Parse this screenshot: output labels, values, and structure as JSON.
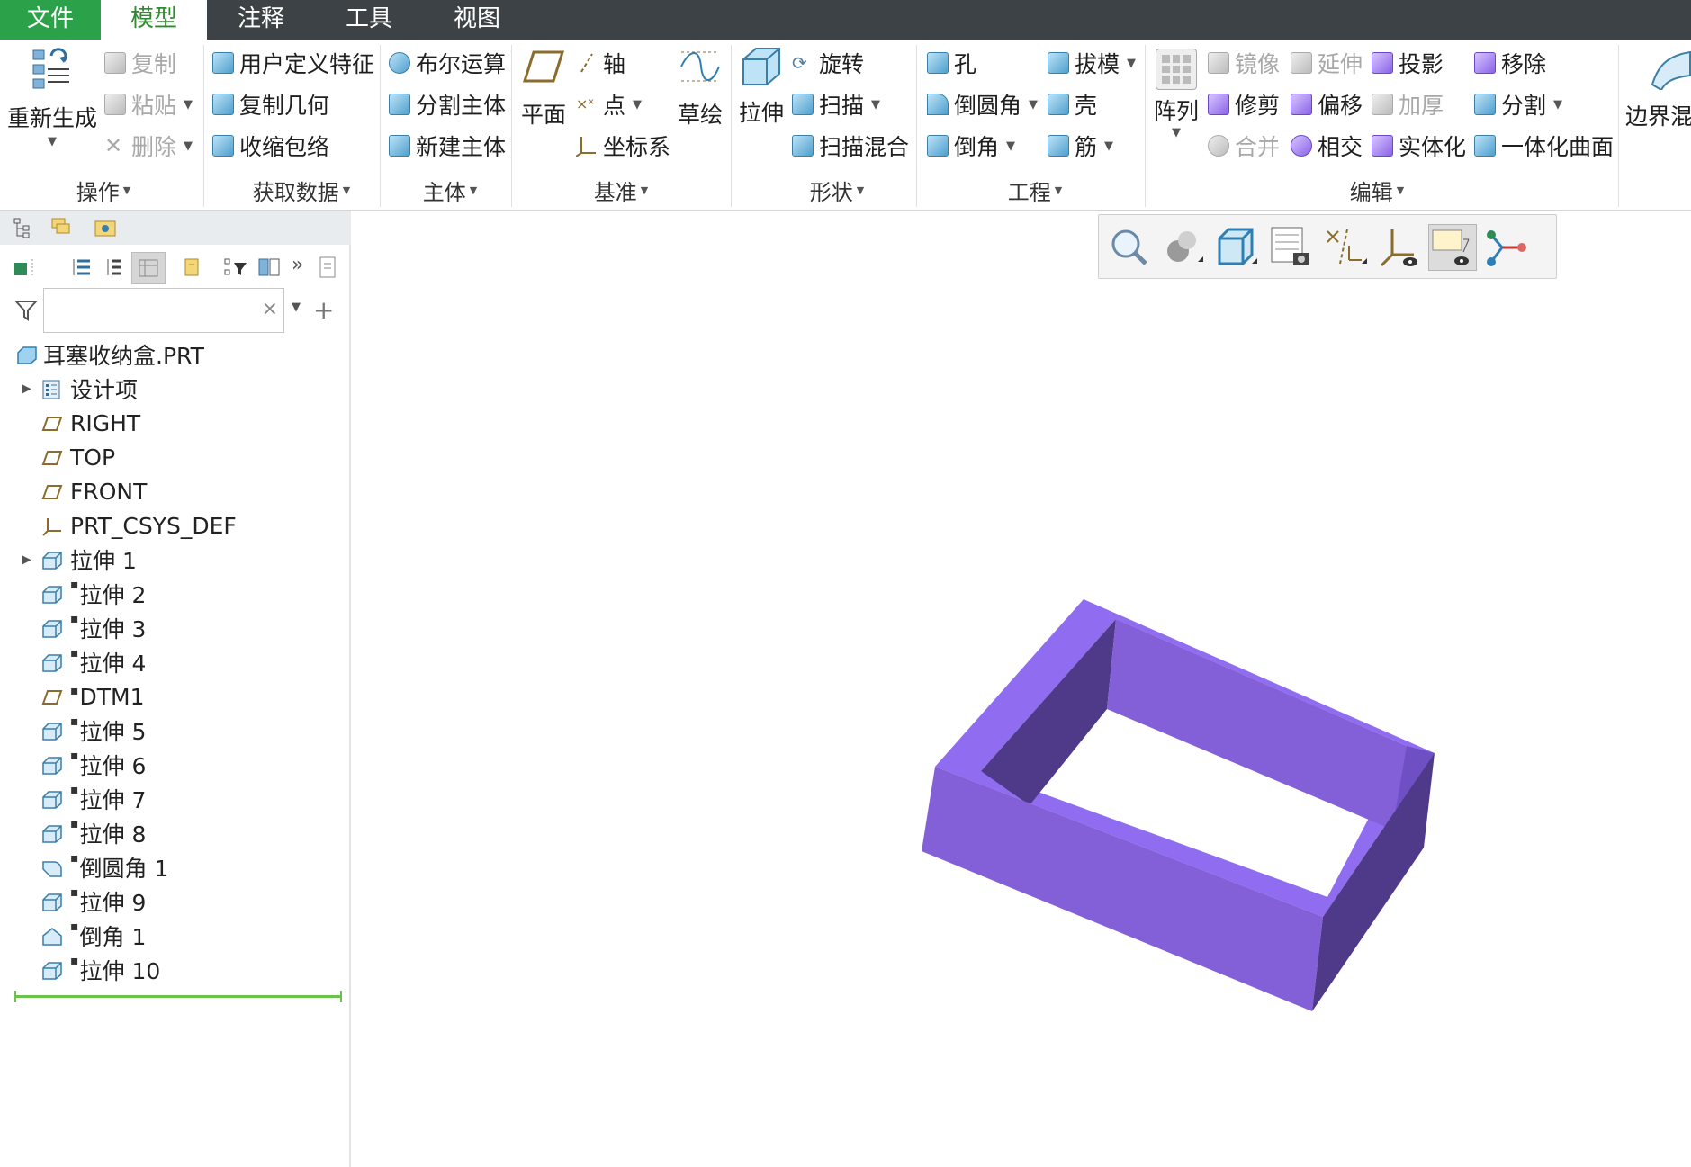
{
  "menubar": {
    "file": "文件",
    "tabs": [
      "模型",
      "注释",
      "工具",
      "视图"
    ]
  },
  "ribbon": {
    "operations": {
      "regenerate": "重新生成",
      "copy": "复制",
      "paste": "粘贴",
      "delete": "删除",
      "group": "操作"
    },
    "get_data": {
      "udf": "用户定义特征",
      "copy_geom": "复制几何",
      "shrinkwrap": "收缩包络",
      "group": "获取数据"
    },
    "body": {
      "boolean": "布尔运算",
      "split_body": "分割主体",
      "new_body": "新建主体",
      "group": "主体"
    },
    "datum": {
      "plane": "平面",
      "axis": "轴",
      "point": "点",
      "csys": "坐标系",
      "sketch": "草绘",
      "group": "基准"
    },
    "shapes": {
      "extrude": "拉伸",
      "revolve": "旋转",
      "sweep": "扫描",
      "swept_blend": "扫描混合",
      "group": "形状"
    },
    "engineering": {
      "hole": "孔",
      "round": "倒圆角",
      "chamfer": "倒角",
      "draft": "拔模",
      "shell": "壳",
      "rib": "筋",
      "group": "工程"
    },
    "editing": {
      "pattern": "阵列",
      "mirror": "镜像",
      "trim": "修剪",
      "merge": "合并",
      "extend": "延伸",
      "offset": "偏移",
      "intersect": "相交",
      "project": "投影",
      "thicken": "加厚",
      "solidify": "实体化",
      "remove": "移除",
      "split": "分割",
      "unify_surface": "一体化曲面",
      "group": "编辑"
    },
    "surfaces": {
      "boundary_blend": "边界混"
    }
  },
  "model_tree": {
    "search_value": "",
    "root": "耳塞收纳盒.PRT",
    "items": [
      {
        "label": "设计项",
        "expandable": true,
        "icon": "design-items-icon"
      },
      {
        "label": "RIGHT",
        "icon": "datum-plane-icon"
      },
      {
        "label": "TOP",
        "icon": "datum-plane-icon"
      },
      {
        "label": "FRONT",
        "icon": "datum-plane-icon"
      },
      {
        "label": "PRT_CSYS_DEF",
        "icon": "csys-icon"
      },
      {
        "label": "拉伸 1",
        "expandable": true,
        "icon": "extrude-icon"
      },
      {
        "label": "拉伸 2",
        "marker": true,
        "icon": "extrude-icon"
      },
      {
        "label": "拉伸 3",
        "marker": true,
        "icon": "extrude-icon"
      },
      {
        "label": "拉伸 4",
        "marker": true,
        "icon": "extrude-icon"
      },
      {
        "label": "DTM1",
        "marker": true,
        "icon": "datum-plane-icon"
      },
      {
        "label": "拉伸 5",
        "marker": true,
        "icon": "extrude-icon"
      },
      {
        "label": "拉伸 6",
        "marker": true,
        "icon": "extrude-icon"
      },
      {
        "label": "拉伸 7",
        "marker": true,
        "icon": "extrude-icon"
      },
      {
        "label": "拉伸 8",
        "marker": true,
        "icon": "extrude-icon"
      },
      {
        "label": "倒圆角 1",
        "marker": true,
        "icon": "round-icon"
      },
      {
        "label": "拉伸 9",
        "marker": true,
        "icon": "extrude-icon"
      },
      {
        "label": "倒角 1",
        "marker": true,
        "icon": "chamfer-icon"
      },
      {
        "label": "拉伸 10",
        "marker": true,
        "icon": "extrude-icon"
      }
    ]
  },
  "graphics_toolbar": {
    "icons": [
      "refit-icon",
      "shading-icon",
      "saved-orientations-icon",
      "view-manager-icon",
      "datum-display-icon",
      "csys-display-icon",
      "annotation-display-icon",
      "spin-center-icon"
    ]
  },
  "colors": {
    "file_tab": "#2ba14a",
    "menubar": "#3c4245",
    "model_top": "#8f6cf0",
    "model_front": "#835fd8",
    "model_side": "#4f3a8a"
  }
}
